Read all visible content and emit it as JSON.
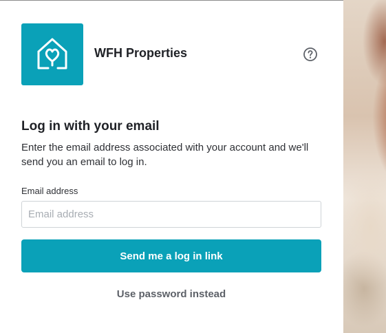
{
  "brand": {
    "name": "WFH Properties",
    "logo_icon": "house-heart-icon",
    "accent_color": "#0aa1b8"
  },
  "help": {
    "icon": "help-circle-icon"
  },
  "login": {
    "heading": "Log in with your email",
    "description": "Enter the email address associated with your account and we'll send you an email to log in.",
    "email_label": "Email address",
    "email_placeholder": "Email address",
    "email_value": "",
    "submit_label": "Send me a log in link",
    "alt_link_label": "Use password instead"
  }
}
